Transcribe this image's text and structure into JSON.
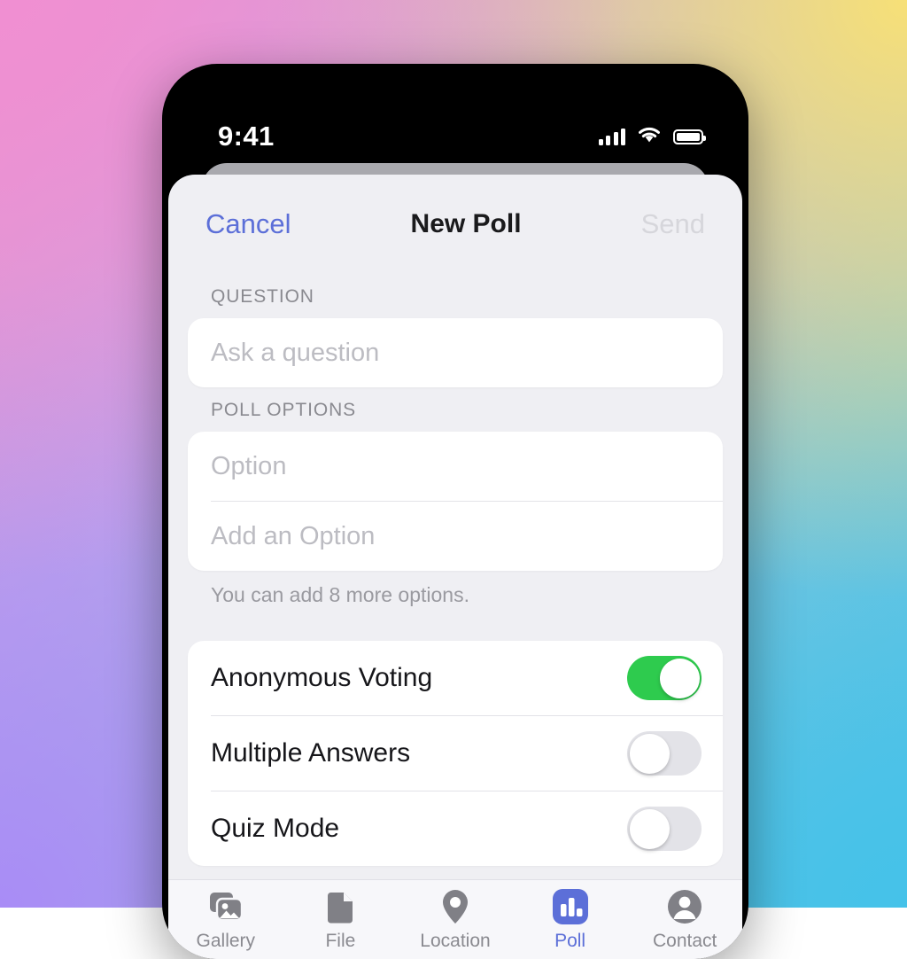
{
  "background": {
    "gradient_colors": [
      "#F08FD2",
      "#F7E077",
      "#A98CF6",
      "#45C2E9"
    ]
  },
  "status_bar": {
    "time": "9:41",
    "cellular_icon": "signal-bars-icon",
    "wifi_icon": "wifi-icon",
    "battery_icon": "battery-full-icon"
  },
  "navbar": {
    "cancel_label": "Cancel",
    "title": "New Poll",
    "send_label": "Send",
    "accent_color": "#5C6FD8",
    "send_disabled_color": "#D6D6DB"
  },
  "question_section": {
    "header": "QUESTION",
    "input_value": "",
    "input_placeholder": "Ask a question"
  },
  "options_section": {
    "header": "POLL OPTIONS",
    "rows": [
      {
        "value": "",
        "placeholder": "Option"
      },
      {
        "value": "",
        "placeholder": "Add an Option"
      }
    ],
    "footnote": "You can add 8 more options."
  },
  "settings_section": {
    "rows": [
      {
        "label": "Anonymous Voting",
        "enabled": true
      },
      {
        "label": "Multiple Answers",
        "enabled": false
      },
      {
        "label": "Quiz Mode",
        "enabled": false
      }
    ],
    "on_color": "#2ECB4E",
    "off_color": "#E3E3E8"
  },
  "tab_bar": {
    "items": [
      {
        "label": "Gallery",
        "icon": "gallery-icon",
        "active": false
      },
      {
        "label": "File",
        "icon": "file-icon",
        "active": false
      },
      {
        "label": "Location",
        "icon": "location-pin-icon",
        "active": false
      },
      {
        "label": "Poll",
        "icon": "poll-bar-chart-icon",
        "active": true
      },
      {
        "label": "Contact",
        "icon": "contact-person-icon",
        "active": false
      }
    ],
    "active_color": "#5C6FD8",
    "inactive_color": "#808086"
  }
}
